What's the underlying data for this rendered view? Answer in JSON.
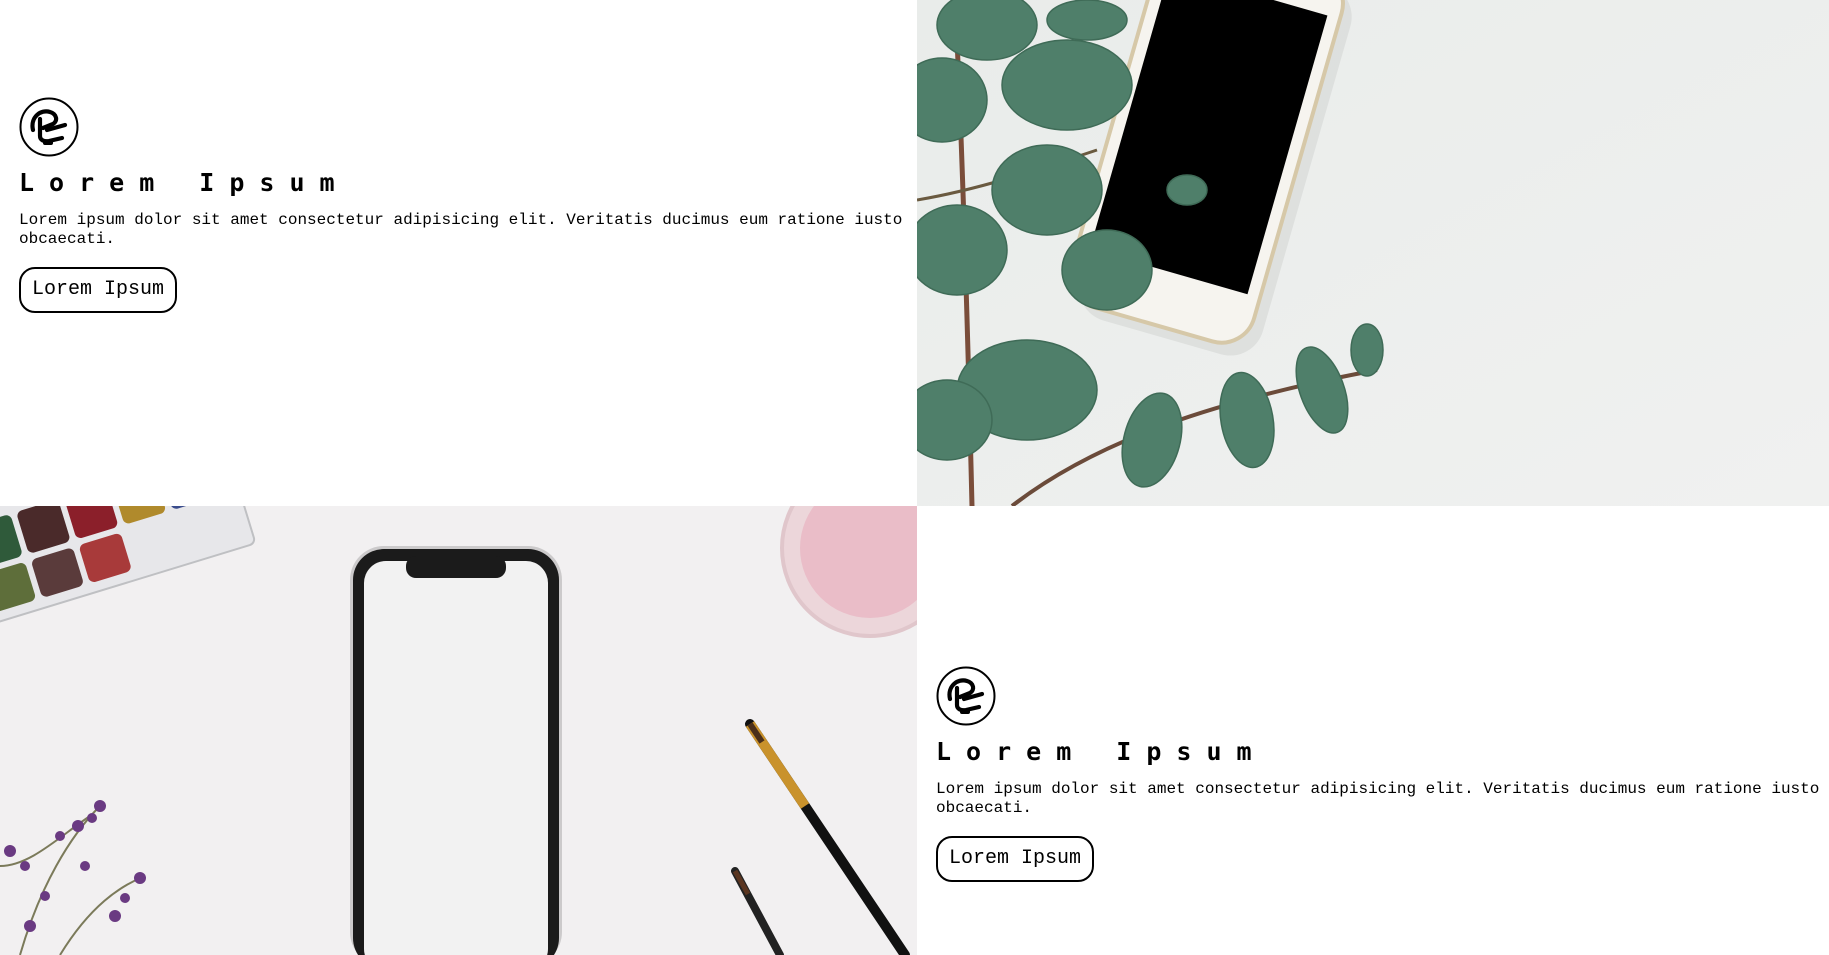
{
  "sections": [
    {
      "title": "Lorem Ipsum",
      "description": "Lorem ipsum dolor sit amet consectetur adipisicing elit. Veritatis ducimus eum ratione iusto obcaecati.",
      "button_label": "Lorem Ipsum",
      "logo_icon": "circular-monogram-logo-icon"
    },
    {
      "title": "Lorem Ipsum",
      "description": "Lorem ipsum dolor sit amet consectetur adipisicing elit. Veritatis ducimus eum ratione iusto obcaecati.",
      "button_label": "Lorem Ipsum",
      "logo_icon": "circular-monogram-logo-icon"
    }
  ],
  "images": [
    {
      "subject": "smartphone with eucalyptus branches",
      "background": "#eceeed"
    },
    {
      "subject": "smartphone with watercolor palette, paint brushes and lavender",
      "background": "#f1eff0"
    }
  ]
}
